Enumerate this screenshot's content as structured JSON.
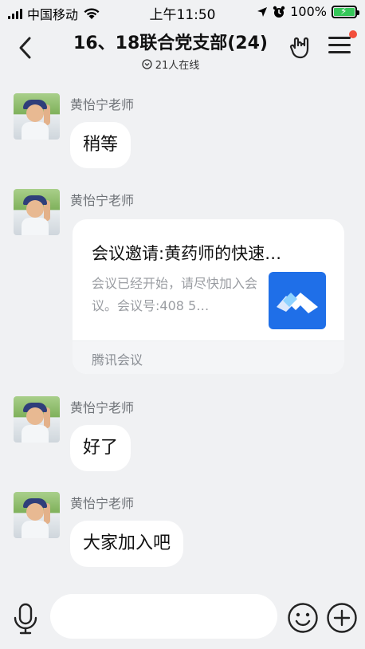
{
  "status_bar": {
    "carrier": "中国移动",
    "time": "上午11:50",
    "battery": "100%"
  },
  "header": {
    "title": "16、18联合党支部(24)",
    "online": "21人在线"
  },
  "messages": [
    {
      "sender": "黄怡宁老师",
      "text": "稍等"
    },
    {
      "sender": "黄怡宁老师",
      "type": "card",
      "card": {
        "title": "会议邀请:黄药师的快速…",
        "desc": "会议已经开始，请尽快加入会议。会议号:408 5…",
        "source": "腾讯会议"
      }
    },
    {
      "sender": "黄怡宁老师",
      "text": "好了"
    },
    {
      "sender": "黄怡宁老师",
      "text": "大家加入吧"
    }
  ],
  "input": {
    "value": "",
    "placeholder": ""
  },
  "colors": {
    "background": "#f0f1f3",
    "bubble": "#ffffff",
    "sender_name": "#6e7277",
    "notification_dot": "#f24e3b",
    "meeting_brand": "#1f6fe8",
    "battery_fill": "#35c759"
  },
  "icons": {
    "back": "chevron-left-icon",
    "hand": "rock-hand-icon",
    "menu": "hamburger-menu-icon",
    "mic": "microphone-icon",
    "emoji": "smiley-icon",
    "plus": "plus-icon",
    "meeting": "tencent-meeting-logo"
  }
}
